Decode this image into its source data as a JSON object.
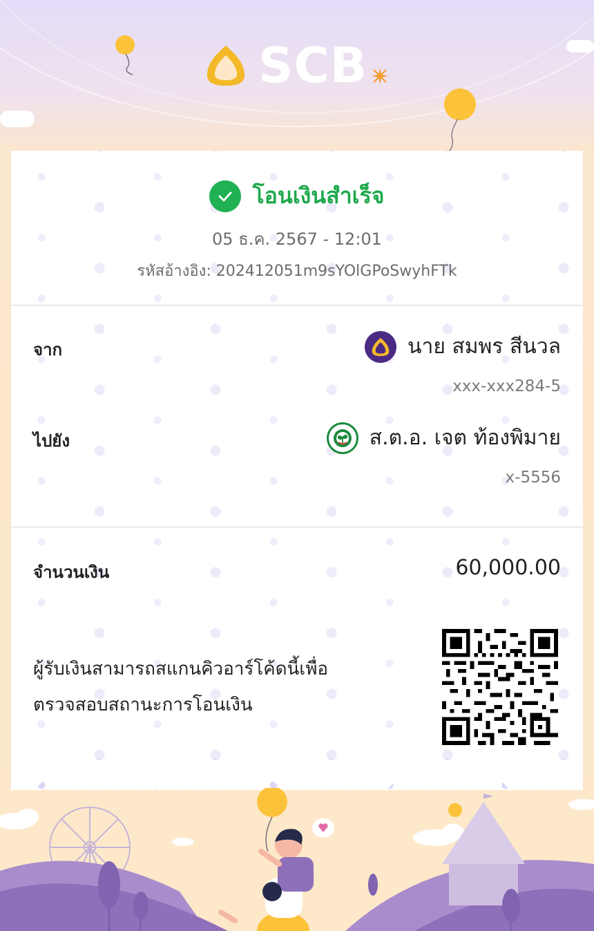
{
  "brand": {
    "name": "SCB"
  },
  "receipt": {
    "status": "โอนเงินสำเร็จ",
    "datetime": "05 ธ.ค. 2567 - 12:01",
    "reference": "รหัสอ้างอิง: 202412051m9sYOlGPoSwyhFTk"
  },
  "sender": {
    "label": "จาก",
    "name": "นาย สมพร สีนวล",
    "account": "xxx-xxx284-5",
    "bank_icon": "scb-bank-icon"
  },
  "recipient": {
    "label": "ไปยัง",
    "name": "ส.ต.อ. เจต ท้องพิมาย",
    "account": "x-5556",
    "bank_icon": "kbank-bank-icon"
  },
  "amount": {
    "label": "จำนวนเงิน",
    "value": "60,000.00"
  },
  "qr": {
    "line1": "ผู้รับเงินสามารถสแกนคิวอาร์โค้ดนี้เพื่อ",
    "line2": "ตรวจสอบสถานะการโอนเงิน"
  },
  "colors": {
    "success": "#1fb152",
    "scb_purple": "#4b2a83",
    "accent_yellow": "#fcc23a",
    "kbank_green": "#1b8a3c"
  }
}
